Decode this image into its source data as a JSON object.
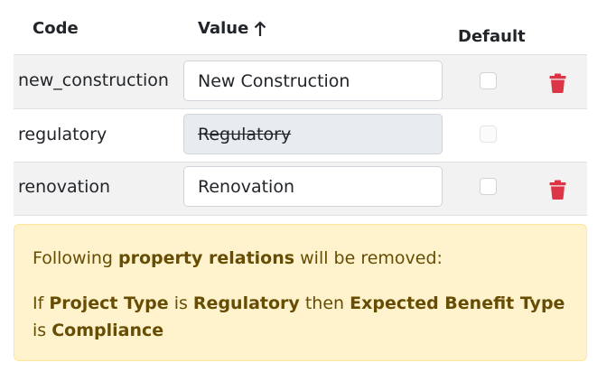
{
  "table": {
    "headers": {
      "code": "Code",
      "value": "Value",
      "default": "Default"
    },
    "sort_icon": "arrow-up-icon",
    "rows": [
      {
        "code": "new_construction",
        "value": "New Construction",
        "disabled": false,
        "default_checked": false,
        "deletable": true
      },
      {
        "code": "regulatory",
        "value": "Regulatory",
        "disabled": true,
        "default_checked": false,
        "deletable": false
      },
      {
        "code": "renovation",
        "value": "Renovation",
        "disabled": false,
        "default_checked": false,
        "deletable": true
      }
    ],
    "delete_icon": "trash-icon"
  },
  "alert": {
    "line1_prefix": "Following",
    "line1_bold": "property relations",
    "line1_suffix": "will be removed:",
    "line2": {
      "if": "If",
      "field1": "Project Type",
      "is1": "is",
      "value1": "Regulatory",
      "then": "then",
      "field2": "Expected Benefit Type",
      "is2": "is",
      "value2": "Compliance"
    }
  },
  "colors": {
    "delete_red": "#dc3545",
    "alert_bg": "#fff3cd",
    "alert_text": "#664d03",
    "stripe": "#f2f2f2"
  }
}
